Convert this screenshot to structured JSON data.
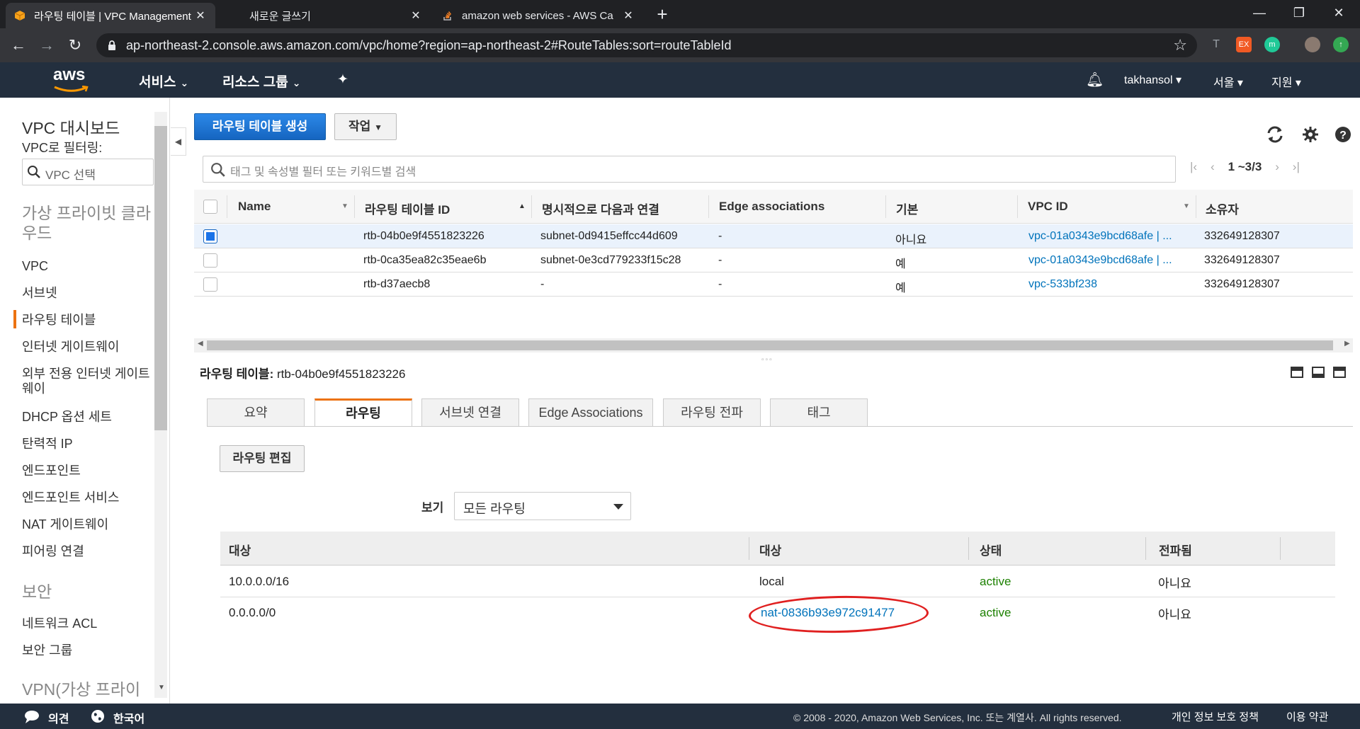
{
  "browser": {
    "tabs": [
      {
        "title": "라우팅 테이블 | VPC Management",
        "active": true
      },
      {
        "title": "새로운 글쓰기",
        "active": false
      },
      {
        "title": "amazon web services - AWS Ca",
        "active": false
      }
    ],
    "close_glyph": "✕",
    "new_tab_glyph": "+",
    "url": "ap-northeast-2.console.aws.amazon.com/vpc/home?region=ap-northeast-2#RouteTables:sort=routeTableId",
    "window": {
      "minimize": "—",
      "maximize": "❐",
      "close": "✕"
    },
    "extension_ex": "EX"
  },
  "awsnav": {
    "logo": "aws",
    "services": "서비스",
    "resource_groups": "리소스 그룹",
    "user": "takhansol",
    "region": "서울",
    "support": "지원"
  },
  "sidebar": {
    "title": "VPC 대시보드",
    "filter_label": "VPC로 필터링:",
    "search_placeholder": "VPC 선택",
    "group_vpc": "가상 프라이빗 클라우드",
    "items": [
      "VPC",
      "서브넷",
      "라우팅 테이블",
      "인터넷 게이트웨이",
      "외부 전용 인터넷 게이트웨이",
      "DHCP 옵션 세트",
      "탄력적 IP",
      "엔드포인트",
      "엔드포인트 서비스",
      "NAT 게이트웨이",
      "피어링 연결"
    ],
    "group_security": "보안",
    "security_items": [
      "네트워크 ACL",
      "보안 그룹"
    ],
    "group_vpn": "VPN(가상 프라이"
  },
  "toolbar": {
    "create_label": "라우팅 테이블 생성",
    "actions_label": "작업"
  },
  "filter": {
    "placeholder": "태그 및 속성별 필터 또는 키워드별 검색",
    "pager": "1 ~3/3"
  },
  "grid": {
    "headers": [
      "Name",
      "라우팅 테이블 ID",
      "명시적으로 다음과 연결",
      "Edge associations",
      "기본",
      "VPC ID",
      "소유자"
    ],
    "rows": [
      {
        "selected": true,
        "name": "",
        "id": "rtb-04b0e9f4551823226",
        "explicit": "subnet-0d9415effcc44d609",
        "edge": "-",
        "main": "아니요",
        "vpc": "vpc-01a0343e9bcd68afe | ...",
        "owner": "332649128307"
      },
      {
        "selected": false,
        "name": "",
        "id": "rtb-0ca35ea82c35eae6b",
        "explicit": "subnet-0e3cd779233f15c28",
        "edge": "-",
        "main": "예",
        "vpc": "vpc-01a0343e9bcd68afe | ...",
        "owner": "332649128307"
      },
      {
        "selected": false,
        "name": "",
        "id": "rtb-d37aecb8",
        "explicit": "-",
        "edge": "-",
        "main": "예",
        "vpc": "vpc-533bf238",
        "owner": "332649128307"
      }
    ]
  },
  "detail": {
    "label": "라우팅 테이블:",
    "value": "rtb-04b0e9f4551823226",
    "tabs": [
      "요약",
      "라우팅",
      "서브넷 연결",
      "Edge Associations",
      "라우팅 전파",
      "태그"
    ],
    "active_tab": 1,
    "edit_routes_label": "라우팅 편집",
    "view_label": "보기",
    "view_value": "모든 라우팅",
    "route_headers": [
      "대상",
      "대상",
      "상태",
      "전파됨"
    ],
    "routes": [
      {
        "destination": "10.0.0.0/16",
        "target": "local",
        "status": "active",
        "propagated": "아니요"
      },
      {
        "destination": "0.0.0.0/0",
        "target": "nat-0836b93e972c91477",
        "status": "active",
        "propagated": "아니요"
      }
    ]
  },
  "footer": {
    "feedback": "의견",
    "language": "한국어",
    "copyright": "© 2008 - 2020, Amazon Web Services, Inc. 또는 계열사. All rights reserved.",
    "privacy": "개인 정보 보호 정책",
    "terms": "이용 약관"
  },
  "colors": {
    "accent": "#ec7211",
    "primary_button": "#1a73e8",
    "link": "#0073bb",
    "active_status": "#1d8102",
    "annotation_circle": "#e02020"
  }
}
